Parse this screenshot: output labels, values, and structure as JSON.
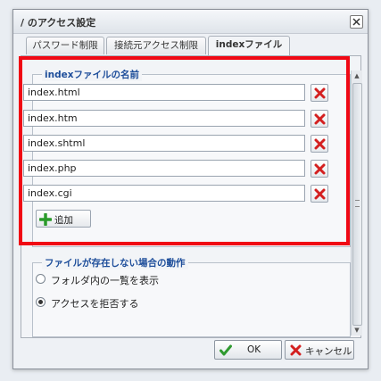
{
  "dialog": {
    "title": "/ のアクセス設定",
    "close_icon": "close-icon"
  },
  "tabs": [
    {
      "label": "パスワード制限",
      "active": false
    },
    {
      "label": "接続元アクセス制限",
      "active": false
    },
    {
      "label": "indexファイル",
      "active": true
    }
  ],
  "index_section": {
    "legend": "indexファイルの名前",
    "files": [
      {
        "value": "index.html"
      },
      {
        "value": "index.htm"
      },
      {
        "value": "index.shtml"
      },
      {
        "value": "index.php"
      },
      {
        "value": "index.cgi"
      }
    ],
    "delete_icon": "red-x-icon",
    "add_label": "追加",
    "add_icon": "green-plus-icon"
  },
  "missing_section": {
    "legend": "ファイルが存在しない場合の動作",
    "options": [
      {
        "label": "フォルダ内の一覧を表示",
        "checked": false
      },
      {
        "label": "アクセスを拒否する",
        "checked": true
      }
    ]
  },
  "footer": {
    "ok_label": "OK",
    "cancel_label": "キャンセル"
  },
  "colors": {
    "highlight": "#f00814",
    "legend": "#1d4d9a",
    "delete": "#d42020",
    "add": "#2a9a2a",
    "ok_check": "#2f9a2f"
  }
}
